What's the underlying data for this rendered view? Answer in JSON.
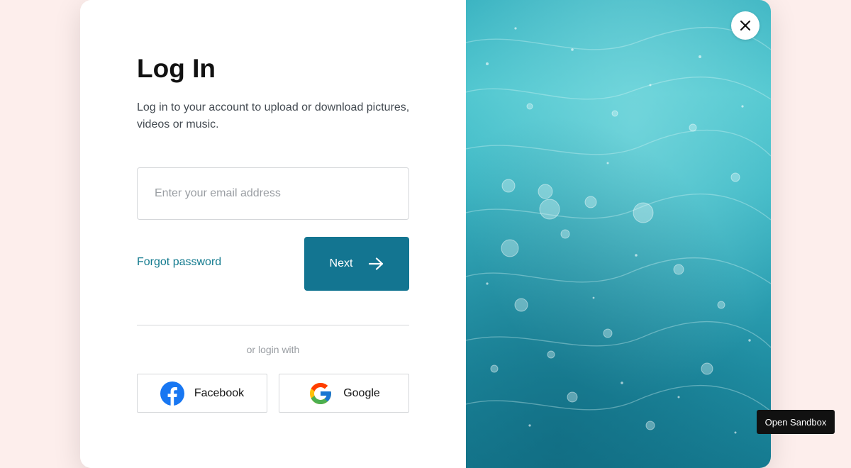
{
  "login": {
    "title": "Log In",
    "subtitle": "Log in to your account to upload or download pictures, videos or music.",
    "email_placeholder": "Enter your email address",
    "email_value": "",
    "forgot_label": "Forgot password",
    "next_label": "Next",
    "next_icon": "arrow-right-icon",
    "divider_text": "or login with",
    "social": {
      "facebook_label": "Facebook",
      "facebook_icon": "facebook-icon",
      "google_label": "Google",
      "google_icon": "google-icon"
    }
  },
  "image_panel": {
    "description_icon": "water-photo",
    "close_icon": "close-icon"
  },
  "sandbox_button": {
    "label": "Open Sandbox"
  },
  "colors": {
    "page_background": "#fdeeec",
    "accent": "#137591",
    "link": "#127a8e",
    "facebook_blue": "#1877f2"
  }
}
